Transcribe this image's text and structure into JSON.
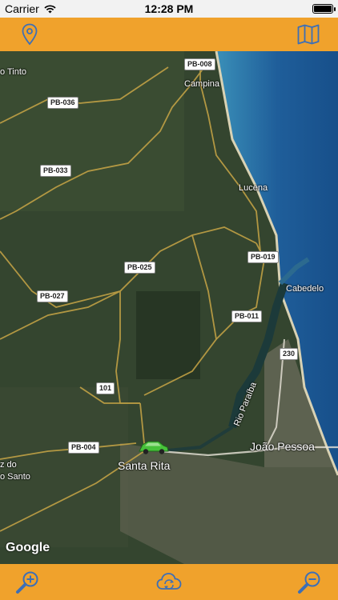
{
  "status": {
    "carrier": "Carrier",
    "time": "12:28 PM"
  },
  "colors": {
    "accent": "#f0a22c",
    "icon": "#3d6fb6"
  },
  "toolbar": {
    "location_icon": "location-pin-icon",
    "map_icon": "folded-map-icon"
  },
  "map": {
    "road_labels": [
      "PB-008",
      "PB-036",
      "PB-033",
      "PB-025",
      "PB-019",
      "PB-027",
      "PB-011",
      "230",
      "101",
      "PB-004"
    ],
    "places": {
      "rio_tinto": "o Tinto",
      "campina": "Campina",
      "lucena": "Lucena",
      "cabedelo": "Cabedelo",
      "rio_paraiba": "Rio Paraíba",
      "joao_pessoa": "João Pessoa",
      "santa_rita": "Santa Rita",
      "cruz_do": "z do",
      "espirito_santo": "o Santo"
    },
    "attribution": "Google"
  },
  "bottom_bar": {
    "zoom_in_icon": "zoom-in-icon",
    "sync_icon": "cloud-sync-icon",
    "zoom_out_icon": "zoom-out-icon"
  }
}
